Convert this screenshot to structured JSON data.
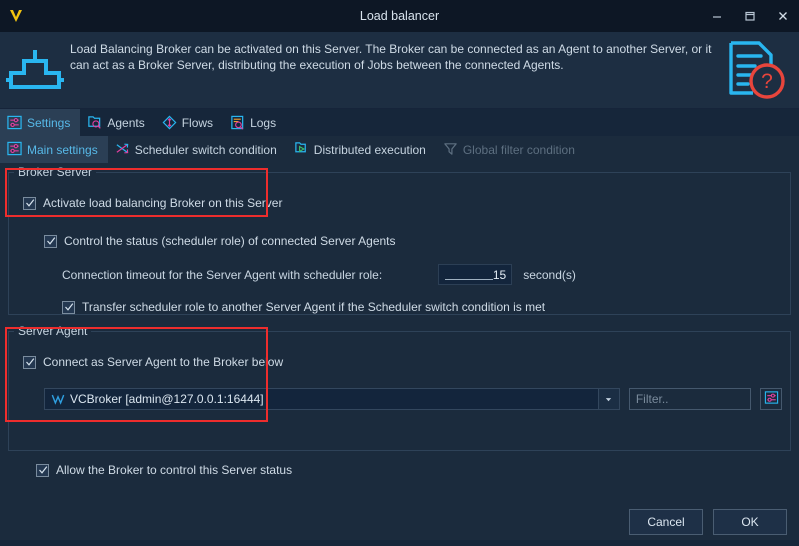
{
  "window": {
    "title": "Load balancer",
    "logo_icon": "vironit-v-logo-icon",
    "minimize_label": "–",
    "maximize_label": "☐",
    "close_label": "✕"
  },
  "banner": {
    "icon": "load-balancer-broker-icon",
    "help_icon": "document-question-help-icon",
    "text": "Load Balancing Broker can be activated on this Server. The Broker can be connected as an Agent to another Server, or it can act as a Broker Server, distributing the execution of Jobs between the connected Agents."
  },
  "tabs": [
    {
      "label": "Settings",
      "icon": "settings-sliders-icon",
      "active": true
    },
    {
      "label": "Agents",
      "icon": "agents-search-icon",
      "active": false
    },
    {
      "label": "Flows",
      "icon": "flows-diamond-icon",
      "active": false
    },
    {
      "label": "Logs",
      "icon": "logs-search-icon",
      "active": false
    }
  ],
  "subtabs": [
    {
      "label": "Main settings",
      "icon": "main-settings-sliders-icon",
      "active": true,
      "disabled": false
    },
    {
      "label": "Scheduler switch condition",
      "icon": "scheduler-switch-arrows-icon",
      "active": false,
      "disabled": false
    },
    {
      "label": "Distributed execution",
      "icon": "distributed-execution-icon",
      "active": false,
      "disabled": false
    },
    {
      "label": "Global filter condition",
      "icon": "filter-funnel-icon",
      "active": false,
      "disabled": true
    }
  ],
  "broker_server": {
    "group_title": "Broker Server",
    "activate": {
      "label": "Activate load balancing Broker on this Server",
      "checked": true
    },
    "control_status": {
      "label": "Control the status (scheduler role) of connected Server Agents",
      "checked": true
    },
    "timeout": {
      "label": "Connection timeout for the Server Agent with scheduler role:",
      "value": "15",
      "unit": "second(s)"
    },
    "transfer_role": {
      "label": "Transfer scheduler role to another Server Agent if the Scheduler switch condition is met",
      "checked": true
    }
  },
  "server_agent": {
    "group_title": "Server Agent",
    "connect": {
      "label": "Connect as Server Agent to the Broker below",
      "checked": true
    },
    "broker_combo": {
      "value": "VCBroker [admin@127.0.0.1:16444]",
      "icon": "vcbroker-icon",
      "arrow_icon": "chevron-down-icon"
    },
    "filter": {
      "placeholder": "Filter..",
      "value": ""
    },
    "filter_settings_button_icon": "filter-settings-sliders-icon",
    "allow_control": {
      "label": "Allow the Broker to control this Server status",
      "checked": true
    }
  },
  "footer": {
    "cancel_label": "Cancel",
    "ok_label": "OK"
  },
  "colors": {
    "accent_cyan": "#29b6f0",
    "accent_magenta": "#e040a0",
    "highlight_red": "#ee2d2d",
    "window_bg": "#1b2b3d",
    "titlebar_bg": "#0d1725",
    "banner_bg": "#1d2e42"
  }
}
